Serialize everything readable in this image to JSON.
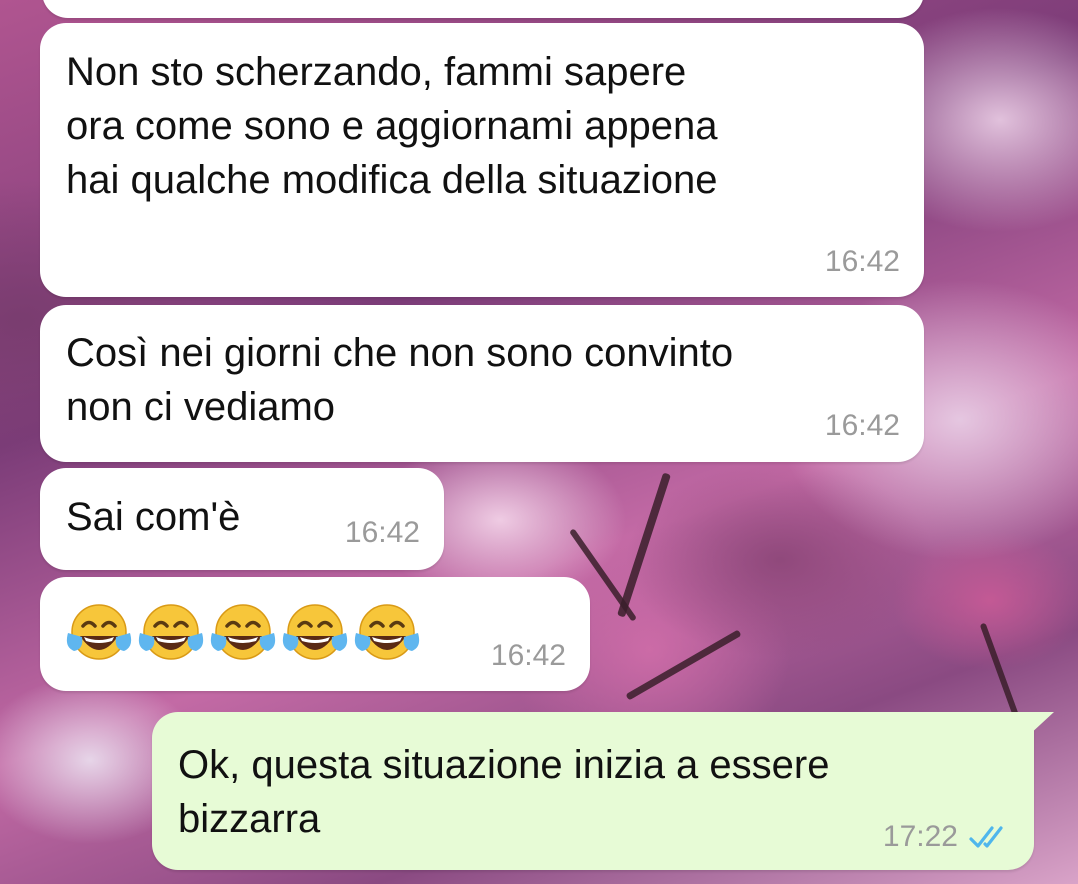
{
  "chat": {
    "messages": [
      {
        "id": "m1",
        "direction": "incoming",
        "text": "Non sto scherzando, fammi sapere\nora come sono e aggiornami appena\nhai qualche modifica della situazione",
        "time": "16:42"
      },
      {
        "id": "m2",
        "direction": "incoming",
        "text": "Così nei giorni che non sono convinto\nnon ci vediamo",
        "time": "16:42"
      },
      {
        "id": "m3",
        "direction": "incoming",
        "text": "Sai com'è",
        "time": "16:42"
      },
      {
        "id": "m4",
        "direction": "incoming",
        "emoji": [
          "face-with-tears-of-joy",
          "face-with-tears-of-joy",
          "face-with-tears-of-joy",
          "face-with-tears-of-joy",
          "face-with-tears-of-joy"
        ],
        "time": "16:42"
      },
      {
        "id": "m5",
        "direction": "outgoing",
        "text": "Ok, questa situazione inizia a essere\nbizzarra",
        "time": "17:22",
        "status": "read",
        "status_icon": "double-check-icon",
        "status_color": "#4fb6ec"
      }
    ]
  },
  "colors": {
    "incoming_bubble": "#ffffff",
    "outgoing_bubble": "#e7fbd6",
    "timestamp": "#9a9a9a"
  }
}
